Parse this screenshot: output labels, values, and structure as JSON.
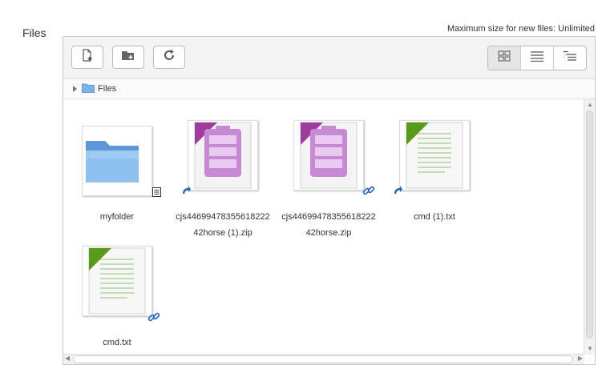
{
  "form": {
    "label": "Files",
    "max_size_text": "Maximum size for new files: Unlimited"
  },
  "toolbar": {
    "buttons": [
      {
        "name": "add-file-button",
        "icon": "add-file-icon"
      },
      {
        "name": "create-folder-button",
        "icon": "add-folder-icon"
      },
      {
        "name": "refresh-button",
        "icon": "refresh-icon"
      }
    ],
    "views": [
      {
        "name": "view-icons-button",
        "icon": "grid-view-icon",
        "active": true
      },
      {
        "name": "view-details-button",
        "icon": "list-view-icon",
        "active": false
      },
      {
        "name": "view-tree-button",
        "icon": "tree-view-icon",
        "active": false
      }
    ]
  },
  "breadcrumb": {
    "items": [
      {
        "label": "Files",
        "icon": "folder-icon"
      }
    ]
  },
  "files": [
    {
      "name": "myfolder",
      "type": "folder",
      "badge": "document-icon"
    },
    {
      "name": "cjs4469947835561822242horse (1).zip",
      "type": "zip",
      "badge": "alias-arrow-icon"
    },
    {
      "name": "cjs4469947835561822242horse.zip",
      "type": "zip",
      "badge": "link-icon"
    },
    {
      "name": "cmd (1).txt",
      "type": "txt",
      "badge": "alias-arrow-icon"
    },
    {
      "name": "cmd.txt",
      "type": "txt",
      "badge": "link-icon"
    }
  ],
  "colors": {
    "zip_ribbon": "#a03ca0",
    "zip_body": "#c58ad3",
    "txt_ribbon": "#5a9a1a",
    "txt_lines": "#8cc070",
    "folder": "#6aa4e0",
    "link": "#2a66b8"
  }
}
